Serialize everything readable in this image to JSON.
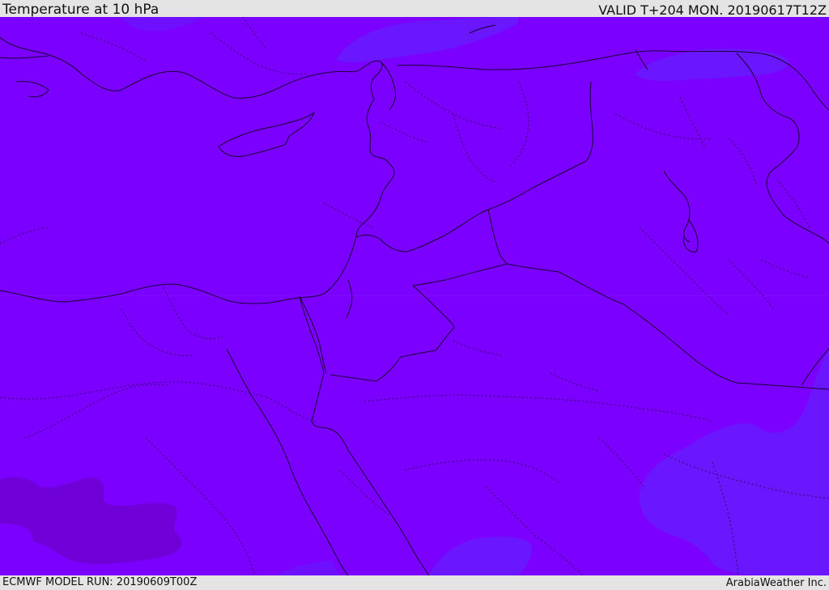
{
  "header": {
    "title": "Temperature at 10 hPa",
    "valid": "VALID T+204 MON. 20190617T12Z"
  },
  "footer": {
    "model_run": "ECMWF MODEL RUN: 20190609T00Z",
    "credit": "ArabiaWeather Inc."
  },
  "map": {
    "colors": {
      "base_fill": "#7b00ff",
      "cooler_blue": "#6a17ff",
      "warm_patch": "#7000d8",
      "border_line": "#1a0033",
      "dotted_line": "#2a0052"
    }
  }
}
